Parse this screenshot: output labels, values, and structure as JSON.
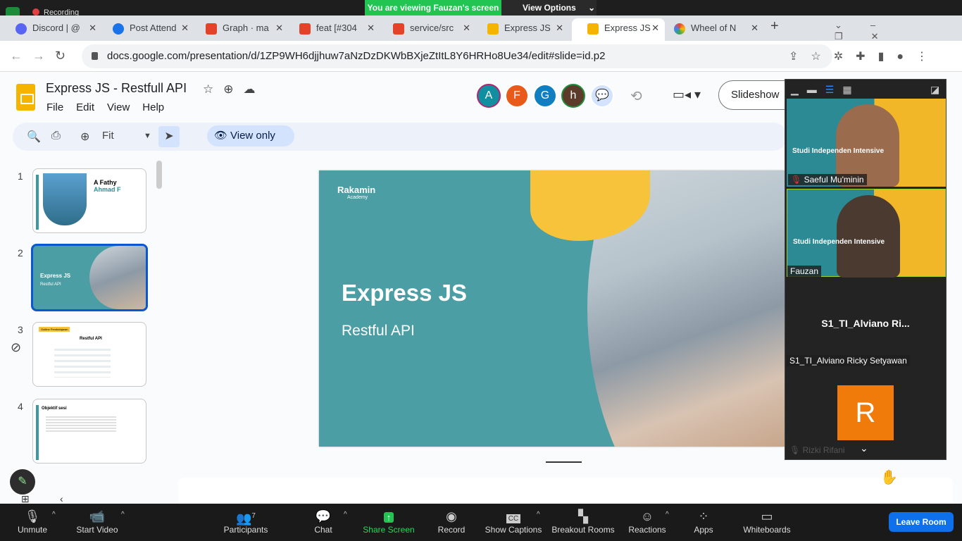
{
  "zoom_top": {
    "banner": "You are viewing Fauzan's screen",
    "view_options": "View Options",
    "recording": "Recording",
    "view": "View"
  },
  "tabs": [
    {
      "label": "Discord | @",
      "color": "#5865f2"
    },
    {
      "label": "Post Attend",
      "color": "#1a73e8"
    },
    {
      "label": "Graph · ma",
      "color": "#e24329"
    },
    {
      "label": "feat [#304",
      "color": "#e24329"
    },
    {
      "label": "service/src",
      "color": "#e24329"
    },
    {
      "label": "Express JS",
      "color": "#f4b400"
    },
    {
      "label": "Express JS",
      "color": "#f4b400",
      "active": true
    },
    {
      "label": "Wheel of N",
      "color": "#4285f4"
    }
  ],
  "address": {
    "url": "docs.google.com/presentation/d/1ZP9WH6djjhuw7aNzDzDKWbBXjeZtItL8Y6HRHo8Ue34/edit#slide=id.p2"
  },
  "doc": {
    "title": "Express JS - Restfull API",
    "menus": [
      "File",
      "Edit",
      "View",
      "Help"
    ],
    "slideshow": "Slideshow"
  },
  "avatars": [
    {
      "letter": "A",
      "color": "#0f8fa0"
    },
    {
      "letter": "F",
      "color": "#e8591a"
    },
    {
      "letter": "G",
      "color": "#0f7fc1"
    },
    {
      "letter": "h",
      "color": "#5d3b2a"
    }
  ],
  "toolbar": {
    "zoom": "Fit",
    "view_only": "View only"
  },
  "thumbnails": [
    {
      "num": "1",
      "title": "A Fathy",
      "title2": "Ahmad F"
    },
    {
      "num": "2",
      "title": "Express JS",
      "subtitle": "Restful API"
    },
    {
      "num": "3",
      "badge": "Outline Pembelajaran",
      "title": "Restful API"
    },
    {
      "num": "4",
      "title": "Objektif sesi"
    }
  ],
  "slide": {
    "logo": "Rakamin",
    "logo_sub": "Academy",
    "title": "Express JS",
    "subtitle": "Restful API"
  },
  "participants_panel": {
    "tiles": [
      {
        "name": "Saeful Mu'minin",
        "bg_text": "Studi Independen Intensive"
      },
      {
        "name": "Fauzan",
        "bg_text": "Studi Independen Intensive"
      }
    ],
    "alviano_big": "S1_TI_Alviano  Ri...",
    "alviano": "S1_TI_Alviano Ricky Setyawan",
    "rizki_initial": "R",
    "rizki": "Rizki Rifani",
    "rizki_color": "#f07a0a"
  },
  "bottom": {
    "unmute": "Unmute",
    "start_video": "Start Video",
    "participants": "Participants",
    "participants_count": "7",
    "chat": "Chat",
    "share": "Share Screen",
    "record": "Record",
    "captions": "Show Captions",
    "breakout": "Breakout Rooms",
    "reactions": "Reactions",
    "apps": "Apps",
    "whiteboards": "Whiteboards",
    "leave": "Leave Room"
  }
}
